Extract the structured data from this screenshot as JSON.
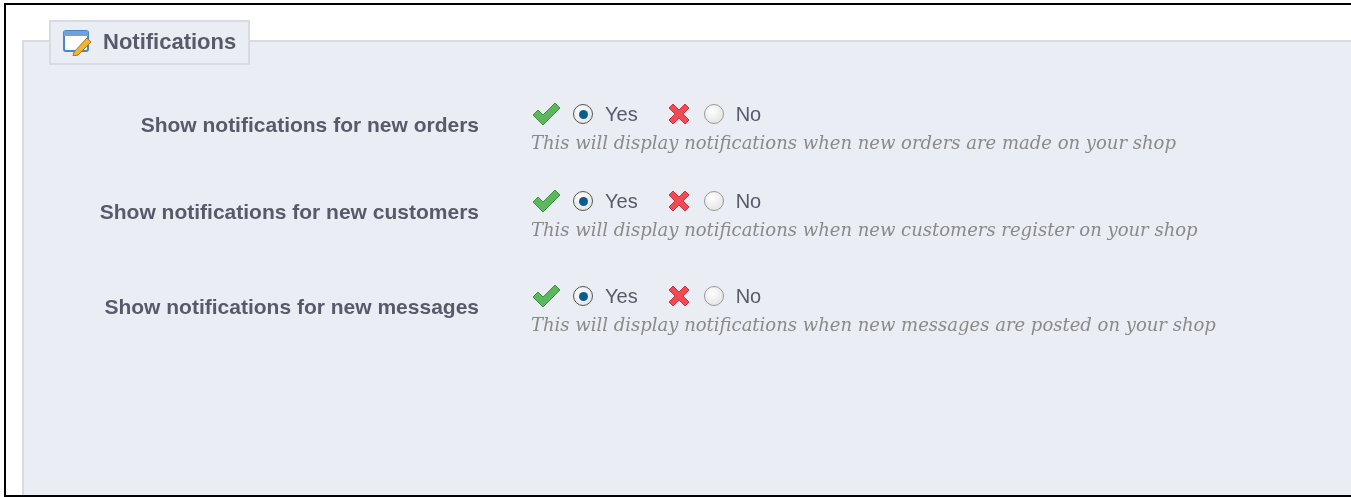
{
  "panel": {
    "title": "Notifications"
  },
  "settings": [
    {
      "label": "Show notifications for new orders",
      "options": [
        {
          "label": "Yes",
          "kind": "yes",
          "selected": true
        },
        {
          "label": "No",
          "kind": "no",
          "selected": false
        }
      ],
      "description": "This will display notifications when new orders are made on your shop"
    },
    {
      "label": "Show notifications for new customers",
      "options": [
        {
          "label": "Yes",
          "kind": "yes",
          "selected": true
        },
        {
          "label": "No",
          "kind": "no",
          "selected": false
        }
      ],
      "description": "This will display notifications when new customers register on your shop"
    },
    {
      "label": "Show notifications for new messages",
      "options": [
        {
          "label": "Yes",
          "kind": "yes",
          "selected": true
        },
        {
          "label": "No",
          "kind": "no",
          "selected": false
        }
      ],
      "description": "This will display notifications when new messages are posted on your shop"
    }
  ]
}
